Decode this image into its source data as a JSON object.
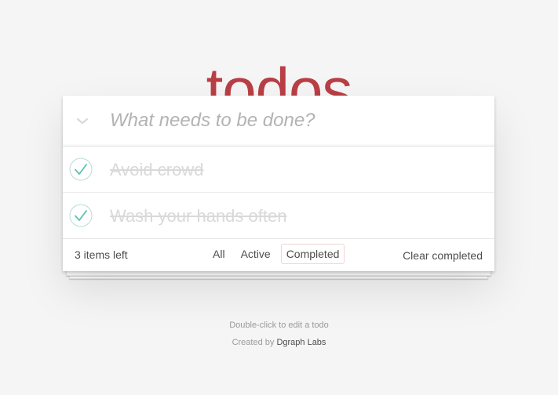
{
  "app": {
    "title": "todos"
  },
  "new_todo": {
    "placeholder": "What needs to be done?"
  },
  "todos": [
    {
      "label": "Avoid crowd",
      "completed": true
    },
    {
      "label": "Wash your hands often",
      "completed": true
    }
  ],
  "footer": {
    "items_left": "3 items left",
    "filters": [
      "All",
      "Active",
      "Completed"
    ],
    "selected_filter": "Completed",
    "clear_completed": "Clear completed"
  },
  "info": {
    "hint": "Double-click to edit a todo",
    "created_by_prefix": "Created by",
    "created_by_link": "Dgraph Labs"
  },
  "colors": {
    "title": "#b83f45",
    "check": "#5dc2af",
    "completed_text": "#d9d9d9",
    "background": "#f5f5f5"
  }
}
